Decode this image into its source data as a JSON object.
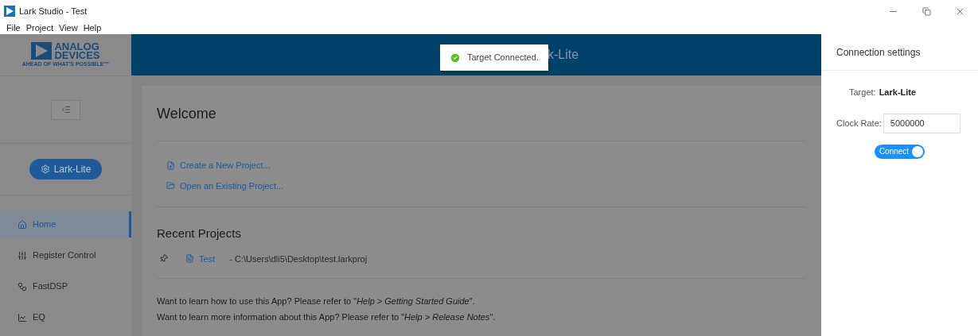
{
  "window": {
    "title": "Lark Studio - Test"
  },
  "menu": [
    "File",
    "Project",
    "View",
    "Help"
  ],
  "logo": {
    "line_1": "ANALOG",
    "line_2": "DEVICES",
    "tagline": "AHEAD OF WHAT'S POSSIBLE™"
  },
  "device_button": {
    "label": "Lark-Lite"
  },
  "sidebar": {
    "items": [
      {
        "label": "Home",
        "kind": "home",
        "selected": true
      },
      {
        "label": "Register Control",
        "kind": "register",
        "selected": false
      },
      {
        "label": "FastDSP",
        "kind": "nodes",
        "selected": false
      },
      {
        "label": "EQ",
        "kind": "chart",
        "selected": false
      }
    ]
  },
  "header": {
    "title": "k-Lite"
  },
  "toast": {
    "message": "Target Connected."
  },
  "welcome": {
    "title": "Welcome",
    "actions": [
      {
        "label": "Create a New Project...",
        "kind": "create"
      },
      {
        "label": "Open an Existing Project...",
        "kind": "open"
      }
    ]
  },
  "recent_projects": {
    "title": "Recent Projects",
    "items": [
      {
        "name": "Test",
        "path": "- C:\\Users\\dli5\\Desktop\\test.larkproj"
      }
    ]
  },
  "help_lines": [
    "Want to learn how to use this App? Please refer to \"*Help > Getting Started Guide*\".",
    "Want to learn more information about this App? Please refer to \"*Help > Release Notes*\"."
  ],
  "connection_settings": {
    "title": "Connection settings",
    "target_label": "Target:",
    "target_value": "Lark-Lite",
    "clock_rate_label": "Clock Rate:",
    "clock_rate_value": "5000000",
    "connect_switch": {
      "label": "Connect",
      "on": true
    }
  }
}
